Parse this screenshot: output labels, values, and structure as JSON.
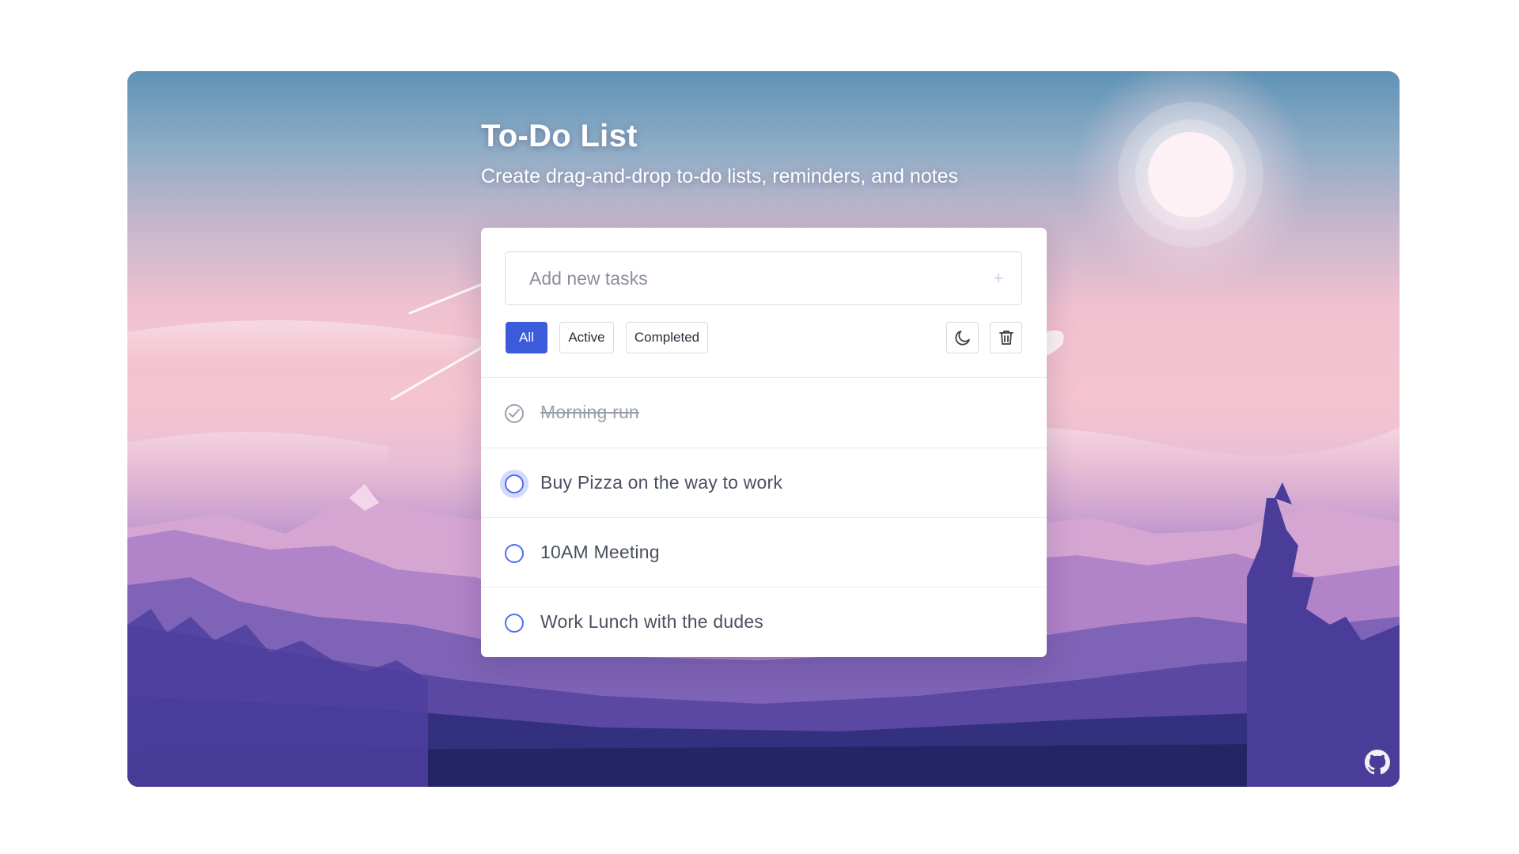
{
  "header": {
    "title": "To-Do List",
    "subtitle": "Create drag-and-drop to-do lists, reminders, and notes"
  },
  "input": {
    "placeholder": "Add new tasks",
    "value": "",
    "add_icon": "plus-icon"
  },
  "filters": {
    "items": [
      {
        "label": "All",
        "active": true
      },
      {
        "label": "Active",
        "active": false
      },
      {
        "label": "Completed",
        "active": false
      }
    ]
  },
  "actions": {
    "theme_icon": "moon-icon",
    "clear_icon": "trash-icon"
  },
  "tasks": [
    {
      "label": "Morning run",
      "completed": true
    },
    {
      "label": "Buy Pizza on the way to work",
      "completed": false
    },
    {
      "label": "10AM Meeting",
      "completed": false
    },
    {
      "label": "Work Lunch with the dudes",
      "completed": false
    }
  ],
  "footer": {
    "icon": "github-icon"
  },
  "colors": {
    "accent": "#3b5bdb",
    "checkbox": "#4c6ef5",
    "completed_text": "#9aa0aa",
    "task_text": "#4b5060"
  }
}
